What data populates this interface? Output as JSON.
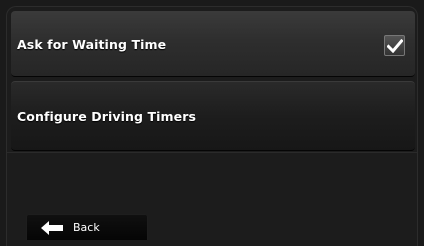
{
  "settings": {
    "items": [
      {
        "label": "Ask for Waiting Time",
        "checked": true,
        "icon": "check-icon"
      },
      {
        "label": "Configure Driving Timers"
      }
    ]
  },
  "footer": {
    "back_label": "Back",
    "back_icon": "arrow-left-icon"
  },
  "colors": {
    "background": "#1c1c1c",
    "row_highlight": "#2e2e2e",
    "text": "#ffffff"
  }
}
